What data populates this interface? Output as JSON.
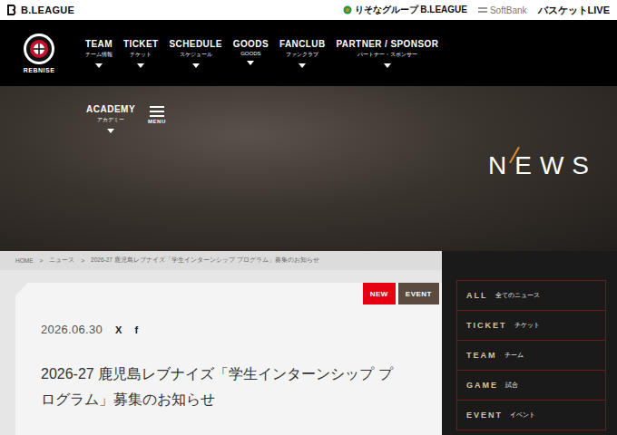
{
  "header": {
    "league_logo": "B.LEAGUE",
    "sponsors": [
      {
        "label": "りそなグループ B.LEAGUE",
        "kind": "resona"
      },
      {
        "label": "SoftBank",
        "kind": "softbank"
      },
      {
        "label": "バスケットLIVE",
        "kind": "live"
      }
    ]
  },
  "club_logo": {
    "name": "REBNISE"
  },
  "nav": [
    {
      "label": "TEAM",
      "sub": "チーム情報"
    },
    {
      "label": "TICKET",
      "sub": "チケット"
    },
    {
      "label": "SCHEDULE",
      "sub": "スケジュール"
    },
    {
      "label": "GOODS",
      "sub": "GOODS"
    },
    {
      "label": "FANCLUB",
      "sub": "ファンクラブ"
    },
    {
      "label": "PARTNER / SPONSOR",
      "sub": "パートナー・スポンサー"
    }
  ],
  "hero": {
    "academy": {
      "label": "ACADEMY",
      "sub": "アカデミー"
    },
    "menu": "MENU",
    "title": "NEWS"
  },
  "breadcrumb": {
    "separator": ">",
    "items": [
      "HOME",
      "ニュース",
      "2026-27 鹿児島レブナイズ「学生インターンシップ プログラム」募集のお知らせ"
    ]
  },
  "article": {
    "badges": [
      {
        "label": "NEW",
        "color": "#e60012"
      },
      {
        "label": "EVENT",
        "color": "#5b4a40"
      }
    ],
    "date": "2026.06.30",
    "share": [
      "X",
      "f"
    ],
    "title": "2026-27 鹿児島レブナイズ「学生インターンシップ プログラム」募集のお知らせ"
  },
  "sidebar": [
    {
      "label": "ALL",
      "sub": "全てのニュース"
    },
    {
      "label": "TICKET",
      "sub": "チケット"
    },
    {
      "label": "TEAM",
      "sub": "チーム"
    },
    {
      "label": "GAME",
      "sub": "試合"
    },
    {
      "label": "EVENT",
      "sub": "イベント"
    }
  ]
}
